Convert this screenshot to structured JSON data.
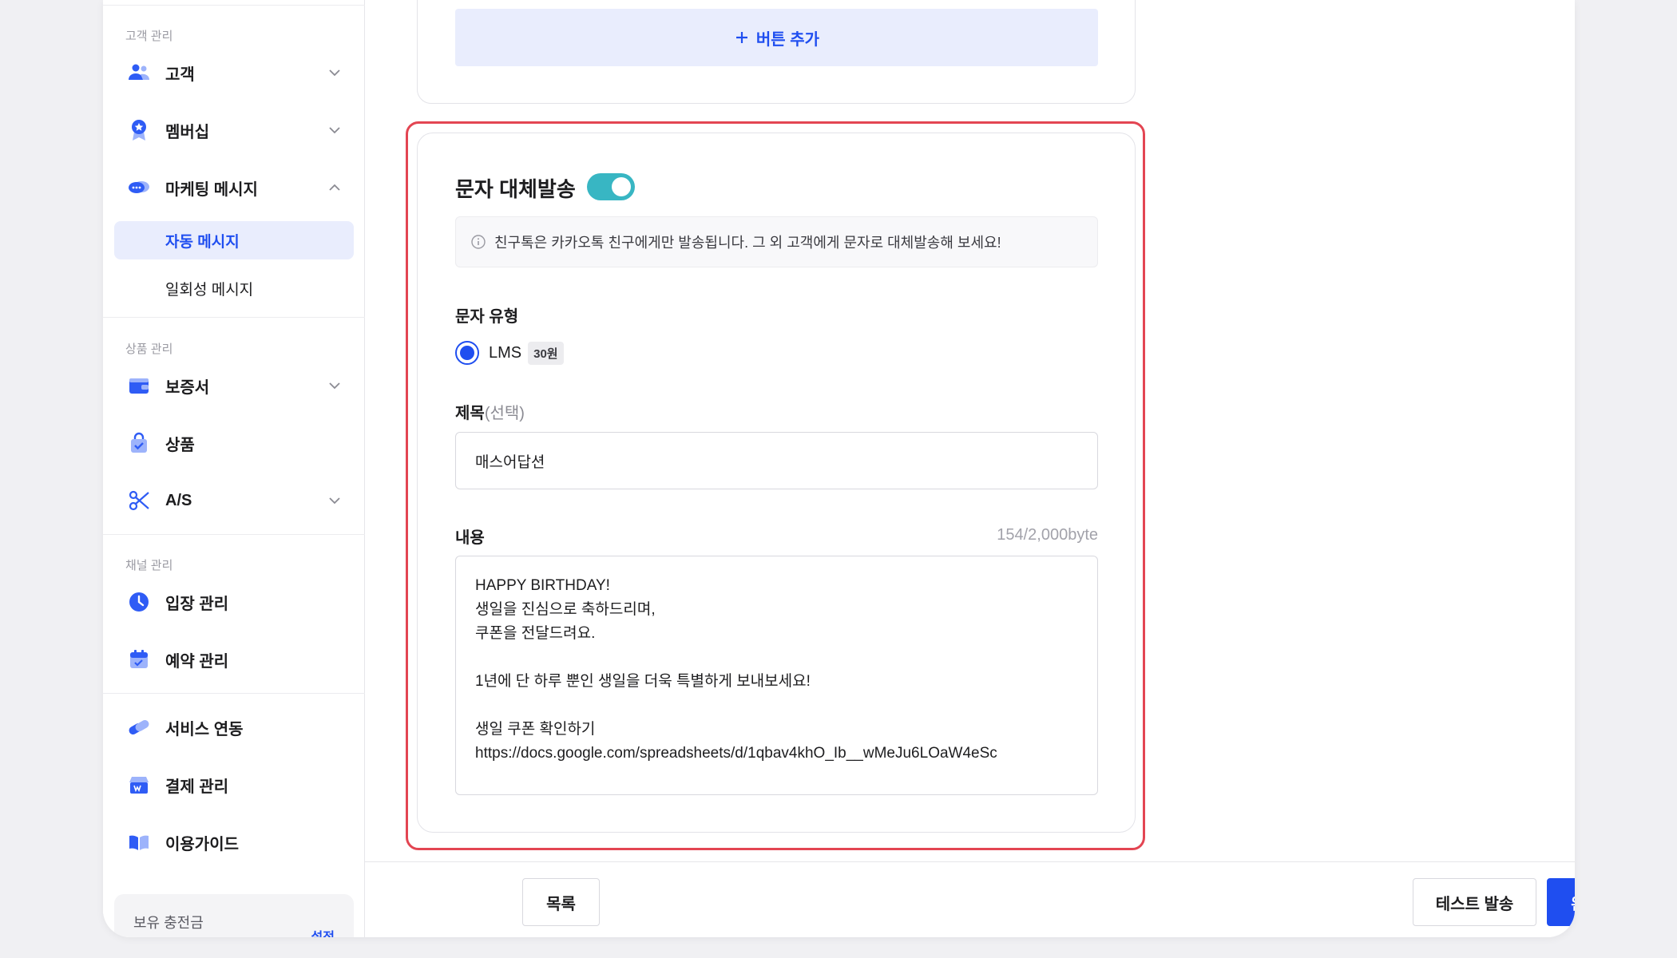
{
  "sidebar": {
    "sections": [
      {
        "title": "고객 관리"
      },
      {
        "title": "상품 관리"
      },
      {
        "title": "채널 관리"
      }
    ],
    "items": {
      "customer": "고객",
      "membership": "멤버십",
      "marketing": "마케팅 메시지",
      "auto_message": "자동 메시지",
      "one_time_message": "일회성 메시지",
      "warranty": "보증서",
      "product": "상품",
      "as": "A/S",
      "entry": "입장 관리",
      "reservation": "예약 관리",
      "service_link": "서비스 연동",
      "payment": "결제 관리",
      "guide": "이용가이드"
    },
    "balance": {
      "label": "보유 충전금",
      "link": "설정"
    }
  },
  "top_card": {
    "add_button_label": "버튼 추가"
  },
  "sms_card": {
    "title": "문자 대체발송",
    "toggle_on": true,
    "info_text": "친구톡은 카카오톡 친구에게만 발송됩니다. 그 외 고객에게 문자로 대체발송해 보세요!",
    "type_label": "문자 유형",
    "type_option": "LMS",
    "type_price": "30원",
    "subject_label": "제목",
    "subject_optional": "(선택)",
    "subject_value": "매스어답션",
    "content_label": "내용",
    "content_counter": "154/2,000byte",
    "content_lines": [
      "HAPPY BIRTHDAY!",
      "생일을 진심으로 축하드리며,",
      "쿠폰을 전달드려요.",
      "",
      "1년에 단 하루 뿐인 생일을 더욱 특별하게 보내보세요!",
      "",
      "생일 쿠폰 확인하기",
      "https://docs.google.com/spreadsheets/d/1qbav4khO_Ib__wMeJu6LOaW4eSc"
    ]
  },
  "footer": {
    "list_button": "목록",
    "test_send_button": "테스트 발송",
    "complete_button": "완료"
  },
  "colors": {
    "accent": "#1f4ef0",
    "toggle": "#38b6c3",
    "highlight": "#e34552"
  }
}
